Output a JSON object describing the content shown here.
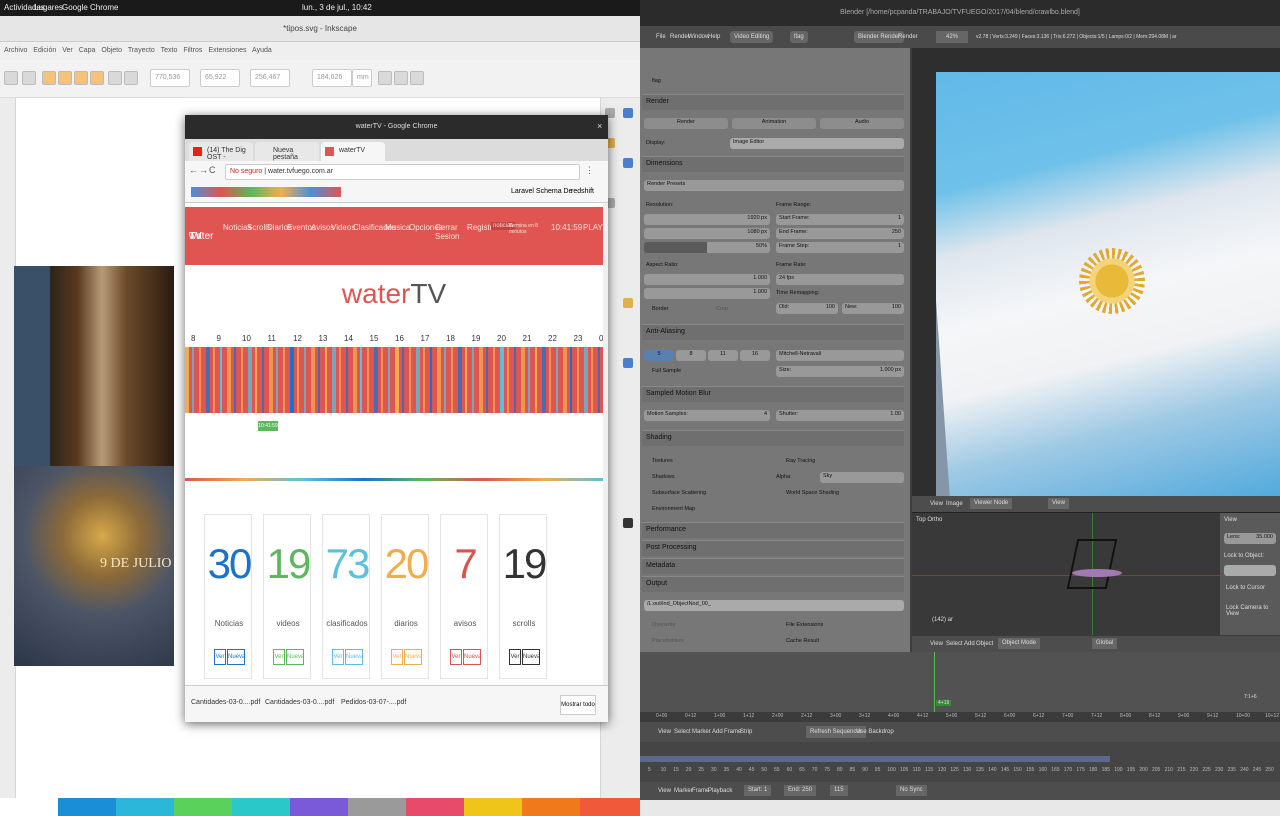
{
  "topbar": {
    "activities": "Actividades",
    "places": "Lugares",
    "app": "Google Chrome",
    "clock": "lun., 3 de jul., 10:42"
  },
  "inkscape": {
    "title": "*tipos.svg - Inkscape",
    "menu": [
      "Archivo",
      "Edición",
      "Ver",
      "Capa",
      "Objeto",
      "Trayecto",
      "Texto",
      "Filtros",
      "Extensiones",
      "Ayuda"
    ],
    "fields": {
      "x": "770,536",
      "y": "65,922",
      "w": "256,467",
      "h": "184,626",
      "unit": "mm"
    },
    "photo_caption": "9 DE JULIO"
  },
  "chrome": {
    "title": "waterTV - Google Chrome",
    "tabs": [
      "(14) The Dig OST - ",
      "Nueva pestaña",
      "waterTV"
    ],
    "security": "No seguro",
    "url": "water.tvfuego.com.ar",
    "bookmarks": [
      "Laravel Schema De",
      "redshift"
    ],
    "nav": [
      "Noticias",
      "Scrolls",
      "Diarios",
      "Eventos",
      "Avisos",
      "Videos",
      "Clasificados",
      "Musica",
      "Opciones",
      "Cerrar Sesion",
      "Registros"
    ],
    "nav_badge": "noticias",
    "nav_hint": "Termina en 8 minutos",
    "nav_time": "10:41:59",
    "nav_play": "PLAY",
    "logo_a": "water",
    "logo_b": "TV",
    "hours": [
      "8",
      "9",
      "10",
      "11",
      "12",
      "13",
      "14",
      "15",
      "16",
      "17",
      "18",
      "19",
      "20",
      "21",
      "22",
      "23",
      "00"
    ],
    "now_label": "10:41:59",
    "cards": [
      {
        "n": "30",
        "label": "Noticias",
        "color": "#1a73c8"
      },
      {
        "n": "19",
        "label": "videos",
        "color": "#5cb85c"
      },
      {
        "n": "73",
        "label": "clasificados",
        "color": "#5bc0de"
      },
      {
        "n": "20",
        "label": "diarios",
        "color": "#f0ad4e"
      },
      {
        "n": "7",
        "label": "avisos",
        "color": "#d9534f"
      },
      {
        "n": "19",
        "label": "scrolls",
        "color": "#333333"
      }
    ],
    "card_btn_view": "Ver",
    "card_btn_new": "Nueva",
    "downloads": [
      "Cantidades-03-0....pdf",
      "Cantidades-03-0....pdf",
      "Pedidos-03-07-....pdf"
    ],
    "show_all": "Mostrar todo"
  },
  "blender": {
    "title": "Blender [/home/pcpanda/TRABAJO/TVFUEGO/2017/04/blend/crawlbo.blend]",
    "menu": [
      "File",
      "Render",
      "Window",
      "Help"
    ],
    "layout": "Video Editing",
    "scene": "flag",
    "engine": "Blender Render",
    "mode": "Render",
    "percent": "42%",
    "stats": "v2.78 | Verts:3.249 | Faces:3.136 | Tris:6.272 | Objects:1/5 | Lamps:0/2 | Mem:294.08M | ar",
    "scene_name": "flag",
    "render_label": "Render",
    "render_btn": "Render",
    "anim_btn": "Animation",
    "audio_btn": "Audio",
    "display_label": "Display:",
    "display_val": "Image Editor",
    "dimensions": "Dimensions",
    "render_presets": "Render Presets",
    "resolution": "Resolution:",
    "res_x": "1920 px",
    "res_y": "1080 px",
    "res_pct": "50%",
    "frame_range": "Frame Range:",
    "start": "Start Frame:",
    "start_v": "1",
    "end": "End Frame:",
    "end_v": "250",
    "step": "Frame Step:",
    "step_v": "1",
    "aspect": "Aspect Ratio:",
    "asp_x": "1.000",
    "asp_y": "1.000",
    "frame_rate": "Frame Rate:",
    "fps": "24 fps",
    "time_remap": "Time Remapping:",
    "old": "Old:",
    "old_v": "100",
    "new": "New:",
    "new_v": "100",
    "border": "Border",
    "crop": "Crop",
    "aa": "Anti-Aliasing",
    "aa_vals": [
      "5",
      "8",
      "11",
      "16"
    ],
    "aa_filter": "Mitchell-Netravali",
    "full_sample": "Full Sample",
    "size": "Size:",
    "size_v": "1.000 px",
    "motion_blur": "Sampled Motion Blur",
    "motion_samples": "Motion Samples:",
    "motion_v": "4",
    "shutter": "Shutter:",
    "shutter_v": "1.00",
    "shading": "Shading",
    "textures": "Textures",
    "shadows": "Shadows",
    "sss": "Subsurface Scattering",
    "envmap": "Environment Map",
    "raytracing": "Ray Tracing",
    "alpha": "Alpha:",
    "alpha_v": "Sky",
    "wss": "World Space Shading",
    "performance": "Performance",
    "postproc": "Post Processing",
    "metadata": "Metadata",
    "output": "Output",
    "output_path": "/L:out/ind_ObjectNod_00_",
    "overwrite": "Overwrite",
    "extensions": "File Extensions",
    "placeholders": "Placeholders",
    "cache": "Cache Result",
    "viewer_menu": [
      "View",
      "Image"
    ],
    "viewer_node": "Viewer Node",
    "viewer_view": "View",
    "vp_menu": [
      "View",
      "Select",
      "Add",
      "Object"
    ],
    "vp_mode": "Object Mode",
    "vp_global": "Global",
    "vp_label": "Top Ortho",
    "vp_obj": "(142) ar",
    "vp_n_view": "View",
    "vp_lens": "Lens:",
    "vp_lens_v": "35.000",
    "vp_lock": "Lock to Object:",
    "vp_cursor": "Lock to Cursor",
    "vp_camera": "Lock Camera to View",
    "seq_ticks": [
      "0+00",
      "0+12",
      "1+00",
      "1+12",
      "2+00",
      "2+12",
      "3+00",
      "3+12",
      "4+00",
      "4+12",
      "5+00",
      "5+12",
      "6+00",
      "6+12",
      "7+00",
      "7+12",
      "8+00",
      "8+12",
      "9+00",
      "9+12",
      "10+00",
      "10+12"
    ],
    "seq_cursor": "4+19",
    "seq_end": "7:1+6",
    "seq_menu": [
      "View",
      "Select",
      "Marker",
      "Add",
      "Frame",
      "Strip"
    ],
    "refresh": "Refresh Sequencer",
    "backdrop": "Use Backdrop",
    "tl_ticks": [
      "5",
      "10",
      "15",
      "20",
      "25",
      "30",
      "35",
      "40",
      "45",
      "50",
      "55",
      "60",
      "65",
      "70",
      "75",
      "80",
      "85",
      "90",
      "95",
      "100",
      "105",
      "110",
      "115",
      "120",
      "125",
      "130",
      "135",
      "140",
      "145",
      "150",
      "155",
      "160",
      "165",
      "170",
      "175",
      "180",
      "185",
      "190",
      "195",
      "200",
      "205",
      "210",
      "215",
      "220",
      "225",
      "230",
      "235",
      "240",
      "245",
      "250"
    ],
    "tl_menu": [
      "View",
      "Marker",
      "Frame",
      "Playback"
    ],
    "tl_start": "Start:",
    "tl_start_v": "1",
    "tl_end": "End:",
    "tl_end_v": "250",
    "tl_cur": "115",
    "tl_sync": "No Sync"
  }
}
